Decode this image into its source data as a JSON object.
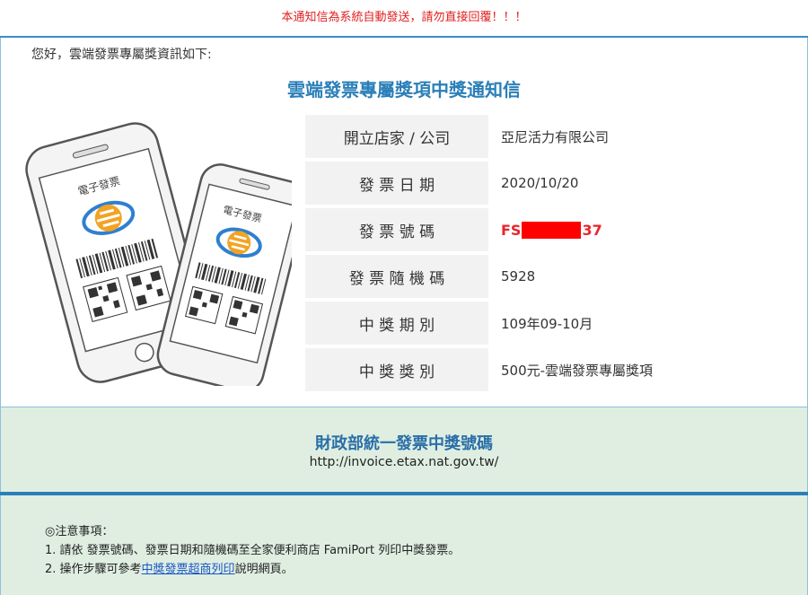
{
  "notice": "本通知信為系統自動發送，請勿直接回覆！！！",
  "greeting": "您好，雲端發票專屬獎資訊如下:",
  "title": "雲端發票專屬獎項中獎通知信",
  "illustration": {
    "phone_label_left": "電子發票",
    "phone_label_right": "電子發票"
  },
  "rows": [
    {
      "label": "開立店家 / 公司",
      "value": "亞尼活力有限公司"
    },
    {
      "label": "發 票 日 期",
      "value": "2020/10/20"
    },
    {
      "label": "發 票 號 碼",
      "value_prefix": "FS",
      "value_suffix": "37"
    },
    {
      "label": "發 票 隨 機 碼",
      "value": "5928"
    },
    {
      "label": "中 獎 期 別",
      "value": "109年09-10月"
    },
    {
      "label": "中 獎 獎 別",
      "value": "500元-雲端發票專屬獎項"
    }
  ],
  "band": {
    "title": "財政部統一發票中獎號碼",
    "url": "http://invoice.etax.nat.gov.tw/"
  },
  "notes": {
    "heading": "◎注意事項：",
    "item1": "1. 請依 發票號碼、發票日期和隨機碼至全家便利商店 FamiPort 列印中獎發票。",
    "item2_prefix": "2. 操作步驟可參考",
    "item2_link": "中獎發票超商列印",
    "item2_suffix": "說明網頁。"
  },
  "colors": {
    "accent": "#2a7fb8",
    "alert": "#e02020",
    "band_bg": "#dfeee1"
  }
}
